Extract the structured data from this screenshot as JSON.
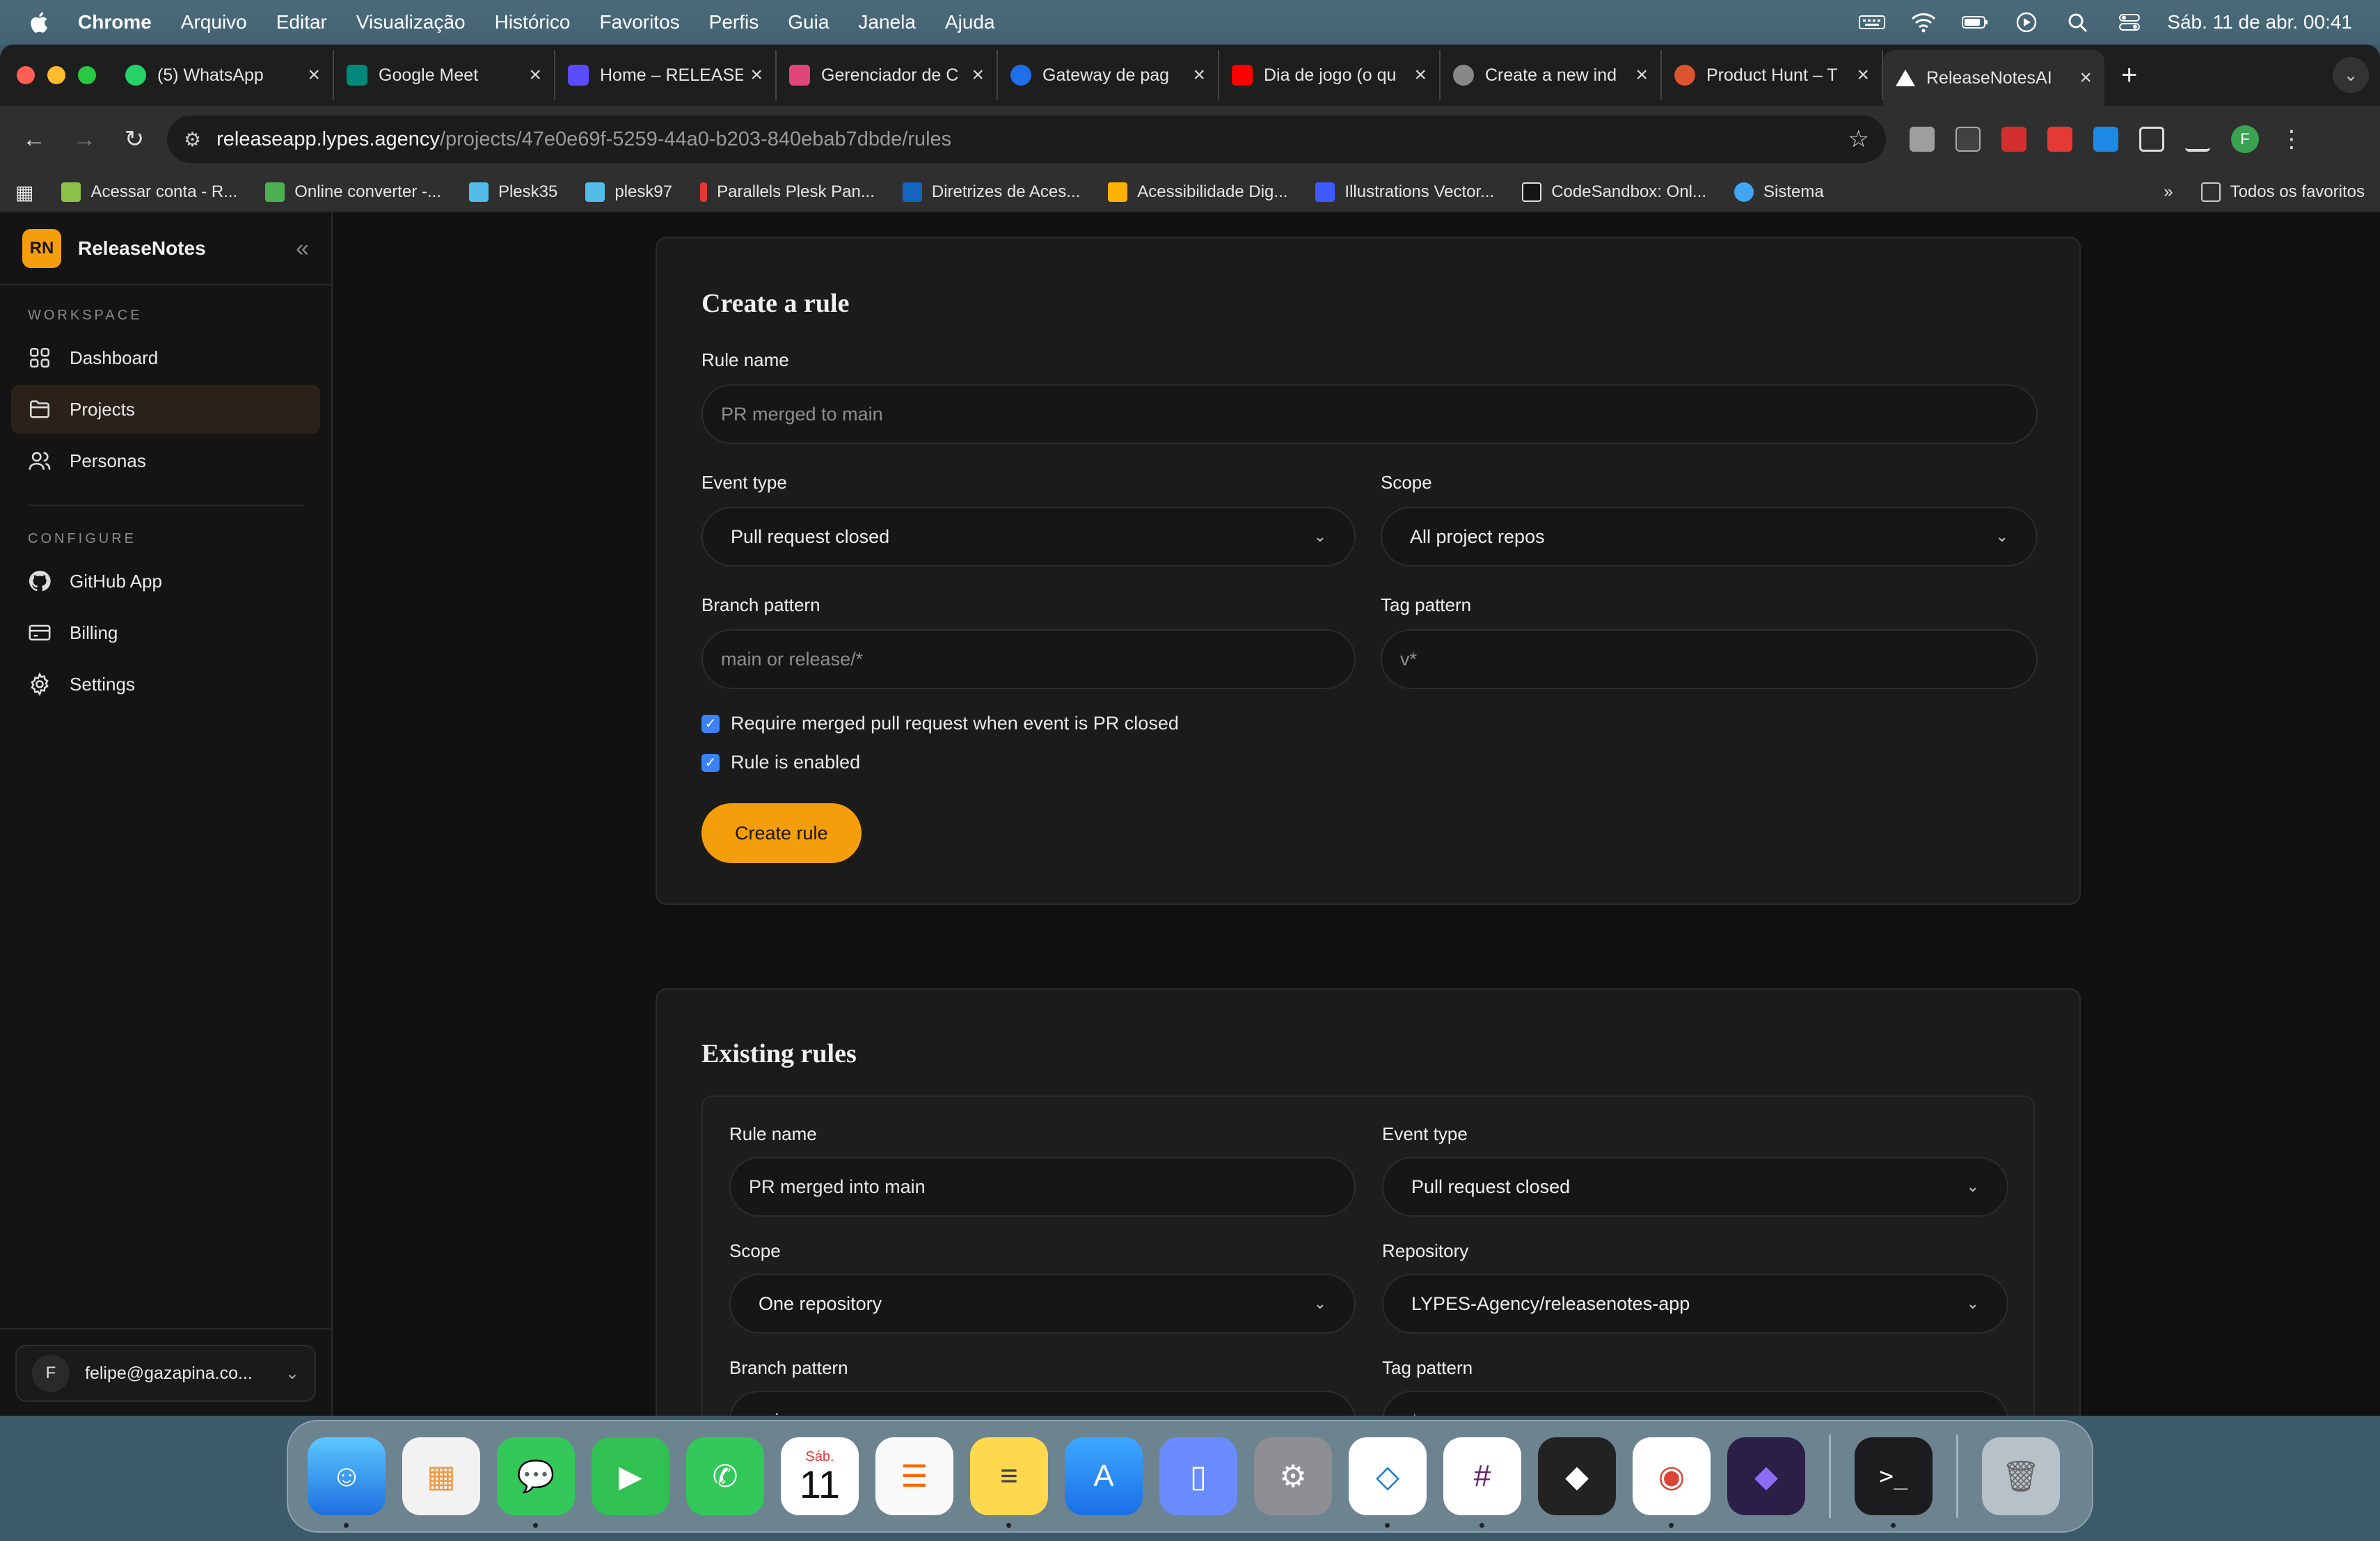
{
  "menubar": {
    "app": "Chrome",
    "items": [
      "Arquivo",
      "Editar",
      "Visualização",
      "Histórico",
      "Favoritos",
      "Perfis",
      "Guia",
      "Janela",
      "Ajuda"
    ],
    "datetime": "Sáb. 11 de abr.  00:41"
  },
  "tabs": [
    {
      "title": "(5) WhatsApp",
      "color": "#25d366"
    },
    {
      "title": "Google Meet",
      "color": "#00897b"
    },
    {
      "title": "Home – RELEASE",
      "color": "#5b4bff"
    },
    {
      "title": "Gerenciador de C",
      "color": "#e0457b"
    },
    {
      "title": "Gateway de pag",
      "color": "#1f6feb"
    },
    {
      "title": "Dia de jogo (o qu",
      "color": "#ff0000"
    },
    {
      "title": "Create a new ind",
      "color": "#888888"
    },
    {
      "title": "Product Hunt – T",
      "color": "#da552f"
    },
    {
      "title": "ReleaseNotesAI",
      "color": "#ffffff"
    }
  ],
  "omnibox": {
    "host": "releaseapp.lypes.agency",
    "path": "/projects/47e0e69f-5259-44a0-b203-840ebab7dbde/rules"
  },
  "bookmarks": [
    {
      "label": "Acessar conta - R...",
      "color": "#8bc34a"
    },
    {
      "label": "Online converter -...",
      "color": "#4caf50"
    },
    {
      "label": "Plesk35",
      "color": "#53bce6"
    },
    {
      "label": "plesk97",
      "color": "#53bce6"
    },
    {
      "label": "Parallels Plesk Pan...",
      "color": "#e53935"
    },
    {
      "label": "Diretrizes de Aces...",
      "color": "#1565c0"
    },
    {
      "label": "Acessibilidade Dig...",
      "color": "#ffb300"
    },
    {
      "label": "Illustrations Vector...",
      "color": "#3d5afe"
    },
    {
      "label": "CodeSandbox: Onl...",
      "color": "#151515"
    },
    {
      "label": "Sistema",
      "color": "#42a5f5"
    }
  ],
  "bookmarks_all": "Todos os favoritos",
  "sidebar": {
    "logo": "RN",
    "brand": "ReleaseNotes",
    "workspace_label": "WORKSPACE",
    "configure_label": "CONFIGURE",
    "workspace": [
      {
        "label": "Dashboard",
        "icon": "grid-icon"
      },
      {
        "label": "Projects",
        "icon": "folder-icon",
        "active": true
      },
      {
        "label": "Personas",
        "icon": "users-icon"
      }
    ],
    "configure": [
      {
        "label": "GitHub App",
        "icon": "github-icon"
      },
      {
        "label": "Billing",
        "icon": "card-icon"
      },
      {
        "label": "Settings",
        "icon": "gear-icon"
      }
    ],
    "account": {
      "initial": "F",
      "email": "felipe@gazapina.co..."
    }
  },
  "create": {
    "title": "Create a rule",
    "rule_name_label": "Rule name",
    "rule_name_placeholder": "PR merged to main",
    "event_type_label": "Event type",
    "event_type_value": "Pull request closed",
    "scope_label": "Scope",
    "scope_value": "All project repos",
    "branch_label": "Branch pattern",
    "branch_placeholder": "main or release/*",
    "tag_label": "Tag pattern",
    "tag_placeholder": "v*",
    "check_merged": "Require merged pull request when event is PR closed",
    "check_enabled": "Rule is enabled",
    "submit": "Create rule"
  },
  "existing": {
    "title": "Existing rules",
    "rule": {
      "rule_name_label": "Rule name",
      "rule_name_value": "PR merged into main",
      "event_type_label": "Event type",
      "event_type_value": "Pull request closed",
      "scope_label": "Scope",
      "scope_value": "One repository",
      "repo_label": "Repository",
      "repo_value": "LYPES-Agency/releasenotes-app",
      "branch_label": "Branch pattern",
      "branch_value": "main",
      "tag_label": "Tag pattern",
      "tag_placeholder": "v*"
    }
  },
  "dock": {
    "calendar_month": "Sáb.",
    "calendar_day": "11"
  }
}
